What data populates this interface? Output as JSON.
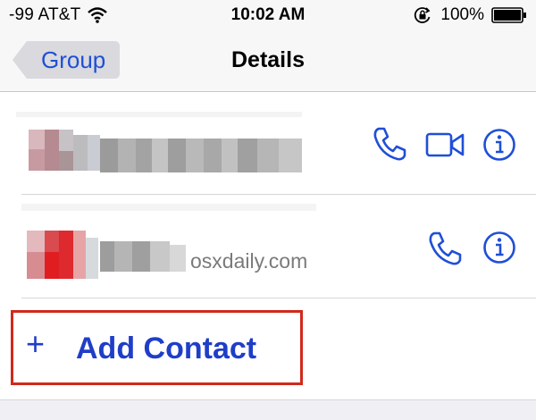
{
  "status_bar": {
    "carrier": "-99 AT&T",
    "time": "10:02 AM",
    "battery": "100%"
  },
  "nav": {
    "back_label": "Group",
    "title": "Details"
  },
  "rows": [
    {
      "actions": [
        "phone-icon",
        "video-camera-icon",
        "info-icon"
      ]
    },
    {
      "actions": [
        "phone-icon",
        "info-icon"
      ]
    }
  ],
  "watermark": "osxdaily.com",
  "add_contact": {
    "plus": "+",
    "label": "Add Contact"
  },
  "colors": {
    "accent": "#1f4fd6",
    "highlight_box": "#d02a1c"
  }
}
